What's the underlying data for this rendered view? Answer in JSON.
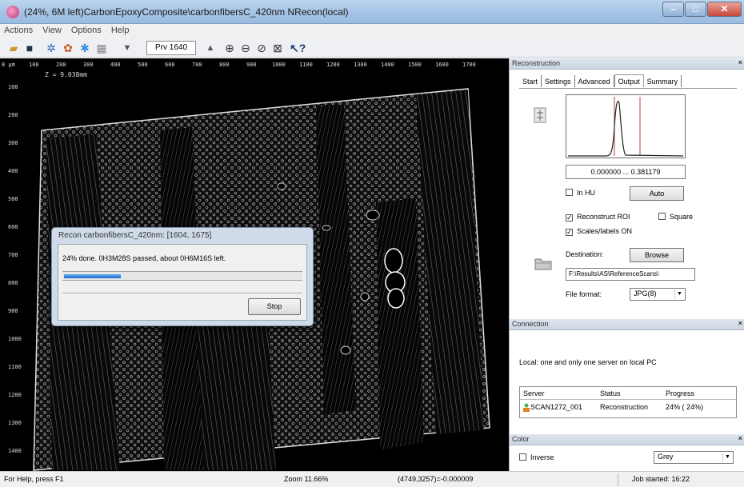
{
  "window": {
    "title": "(24%, 6M left)CarbonEpoxyComposite\\carbonfibersC_420nm  NRecon(local)"
  },
  "menu": [
    "Actions",
    "View",
    "Options",
    "Help"
  ],
  "toolbar": {
    "preview_combo": "Prv 1640",
    "icons": [
      "open-icon",
      "save-icon",
      "settings-icon",
      "palette-icon",
      "asterisk-icon",
      "grid-icon",
      "down-triangle-icon",
      "up-triangle-icon",
      "zoom-in-icon",
      "zoom-out-icon",
      "zoom-fit-icon",
      "fit-window-icon",
      "context-help-icon"
    ]
  },
  "viewer": {
    "ruler_top": [
      "8 µm",
      "100",
      "200",
      "300",
      "400",
      "500",
      "600",
      "700",
      "800",
      "900",
      "1000",
      "1100",
      "1200",
      "1300",
      "1400",
      "1500",
      "1600",
      "1700"
    ],
    "ruler_left": [
      "100",
      "200",
      "300",
      "400",
      "500",
      "600",
      "700",
      "800",
      "900",
      "1000",
      "1100",
      "1200",
      "1300",
      "1400"
    ],
    "z_label": "Z = 9.038mm"
  },
  "progress_dialog": {
    "title": "Recon carbonfibersC_420nm: [1604, 1675]",
    "message": "24% done. 0H3M28S passed, about 0H6M16S left.",
    "progress": 0.24,
    "stop_label": "Stop"
  },
  "reconstruction_panel": {
    "header": "Reconstruction",
    "tabs": [
      "Start",
      "Settings",
      "Advanced",
      "Output",
      "Summary"
    ],
    "active_tab": "Output",
    "range": "0.000000 ... 0.381179",
    "in_hu_label": "In HU",
    "auto_label": "Auto",
    "reconstruct_roi_label": "Reconstruct ROI",
    "square_label": "Square",
    "scales_label": "Scales/labels ON",
    "destination_label": "Destination:",
    "browse_label": "Browse",
    "destination_path": "F:\\Results\\AS\\ReferenceScans\\",
    "file_format_label": "File format:",
    "file_format_value": "JPG(8)"
  },
  "connection_panel": {
    "header": "Connection",
    "info": "Local: one and only one  server on local PC",
    "columns": [
      "Server",
      "Status",
      "Progress"
    ],
    "rows": [
      {
        "server": "SCAN1272_001",
        "status": "Reconstruction",
        "progress": "24% ( 24%)"
      }
    ]
  },
  "color_panel": {
    "header": "Color",
    "inverse_label": "Inverse",
    "colormap": "Grey"
  },
  "statusbar": {
    "help": "For Help, press F1",
    "zoom": "Zoom 11.66%",
    "coords": "(4749,3257)=-0.000009",
    "job": "Job started: 16:22"
  },
  "colors": {
    "progress_fill": "#1f6fd0",
    "histogram_marker": "#c0392b",
    "slice_background": "#000000"
  }
}
